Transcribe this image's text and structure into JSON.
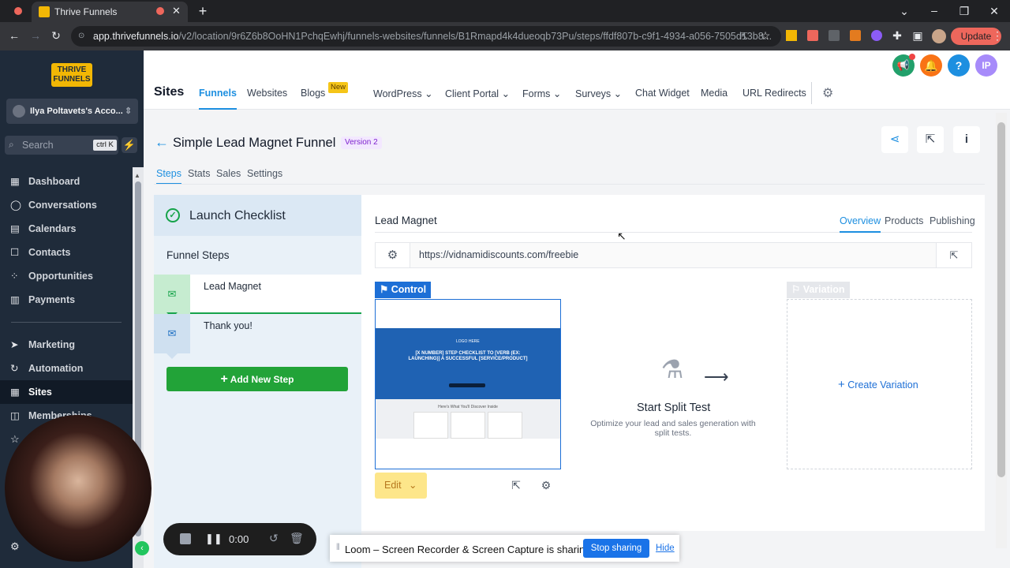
{
  "browser": {
    "tab_title": "Thrive Funnels",
    "url_domain": "app.thrivefunnels.io",
    "url_path": "/v2/location/9r6Z6b8OoHN1PchqEwhj/funnels-websites/funnels/B1Rmapd4k4dueoqb73Pu/steps/ffdf807b-c9f1-4934-a056-7505d13b8...",
    "update_label": "Update"
  },
  "sidebar": {
    "logo_line1": "THRIVE",
    "logo_line2": "FUNNELS",
    "account": "Ilya Poltavets's Acco...",
    "search_placeholder": "Search",
    "search_shortcut": "ctrl K",
    "items": [
      {
        "label": "Dashboard",
        "icon": "dashboard-icon"
      },
      {
        "label": "Conversations",
        "icon": "chat-icon"
      },
      {
        "label": "Calendars",
        "icon": "calendar-icon"
      },
      {
        "label": "Contacts",
        "icon": "contacts-icon"
      },
      {
        "label": "Opportunities",
        "icon": "opportunities-icon"
      },
      {
        "label": "Payments",
        "icon": "payments-icon"
      },
      {
        "label": "Marketing",
        "icon": "marketing-icon"
      },
      {
        "label": "Automation",
        "icon": "automation-icon"
      },
      {
        "label": "Sites",
        "icon": "sites-icon"
      },
      {
        "label": "Memberships",
        "icon": "memberships-icon"
      }
    ]
  },
  "topnav": {
    "title": "Sites",
    "items": [
      "Funnels",
      "Websites",
      "Blogs",
      "WordPress",
      "Client Portal",
      "Forms",
      "Surveys",
      "Chat Widget",
      "Media",
      "URL Redirects"
    ],
    "new_badge": "New",
    "avatar": "IP"
  },
  "funnel": {
    "title": "Simple Lead Magnet Funnel",
    "version": "Version 2",
    "tabs": [
      "Steps",
      "Stats",
      "Sales",
      "Settings"
    ]
  },
  "steps_panel": {
    "checklist": "Launch Checklist",
    "heading": "Funnel Steps",
    "steps": [
      "Lead Magnet",
      "Thank you!"
    ],
    "add_step": "Add New Step"
  },
  "main": {
    "title": "Lead Magnet",
    "tabs": [
      "Overview",
      "Products",
      "Publishing"
    ],
    "url": "https://vidnamidiscounts.com/freebie",
    "control_label": "Control",
    "variation_label": "Variation",
    "thumb_logo": "LOGO HERE",
    "thumb_headline": "[X NUMBER] STEP CHECKLIST TO [VERB (EX: LAUNCHING)] A SUCCESSFUL [SERVICE/PRODUCT]",
    "thumb_sub": "Here's What You'll Discover Inside",
    "edit_label": "Edit",
    "split_title": "Start Split Test",
    "split_desc": "Optimize your lead and sales generation with split tests.",
    "create_variation": "Create Variation"
  },
  "recorder": {
    "time": "0:00"
  },
  "loom": {
    "message": "Loom – Screen Recorder & Screen Capture is sharing your screen.",
    "stop": "Stop sharing",
    "hide": "Hide"
  },
  "colors": {
    "accent": "#1d8fe0",
    "sidebar": "#1f2b3a",
    "success": "#22a338"
  }
}
